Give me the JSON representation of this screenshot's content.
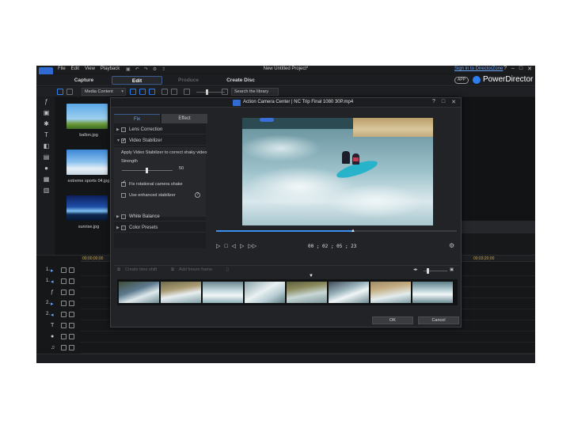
{
  "titlebar": {
    "menu": [
      "File",
      "Edit",
      "View",
      "Playback"
    ],
    "doc_title": "New Untitled Project*",
    "signin": "Sign in to DirectorZone",
    "window_buttons": [
      "?",
      "–",
      "□",
      "✕"
    ]
  },
  "modebar": {
    "tabs": [
      "Capture",
      "Edit",
      "Produce",
      "Create Disc"
    ],
    "active_tab": "Edit",
    "app_badge": "APP",
    "brand": "PowerDirector"
  },
  "library": {
    "media_filter": "Media Content",
    "search_placeholder": "Search the library",
    "items": [
      {
        "label": "ballon.jpg"
      },
      {
        "label": "extreme sports 04.jpg"
      },
      {
        "label": "sunrise.jpg"
      }
    ]
  },
  "timeline": {
    "ruler": [
      "00;00;00;00",
      "00;03;20;00"
    ],
    "tracks": [
      "1.",
      "1.",
      "2.",
      "2.",
      "",
      "",
      "",
      ""
    ]
  },
  "dialog": {
    "title": "Action Camera Center  |  NC Trip Final 1080 30P.mp4",
    "title_buttons": [
      "?",
      "□",
      "✕"
    ],
    "tabs": {
      "fix": "Fix",
      "effect": "Effect"
    },
    "fix_items": {
      "lens_correction": "Lens Correction",
      "video_stabilizer": "Video Stabilizer",
      "white_balance": "White Balance",
      "color_presets": "Color Presets"
    },
    "stabilizer": {
      "description": "Apply Video Stabilizer to correct shaky video",
      "strength_label": "Strength",
      "strength_value": "50",
      "strength_fraction": 0.5,
      "fix_rotational": "Fix rotational camera shake",
      "enhanced": "Use enhanced stabilizer"
    },
    "player": {
      "timecode": "00 ; 02 ; 05 ; 23",
      "progress_fraction": 0.57
    },
    "keyframe_bar": {
      "create_time_shift": "Create time shift",
      "add_freeze_frame": "Add freeze frame"
    },
    "buttons": {
      "ok": "OK",
      "cancel": "Cancel"
    }
  }
}
